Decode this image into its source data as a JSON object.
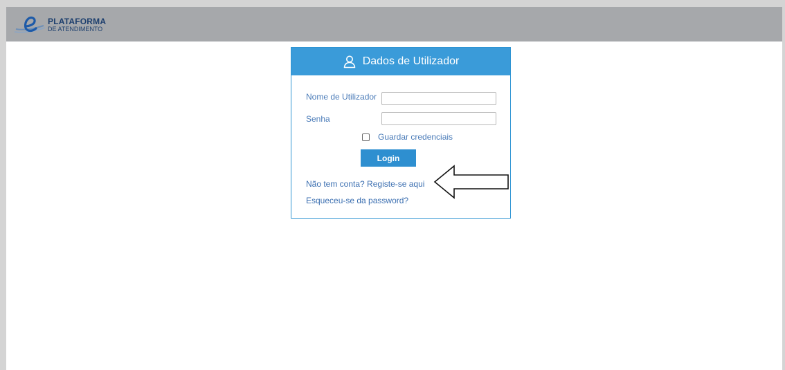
{
  "header": {
    "logo_title": "PLATAFORMA",
    "logo_subtitle": "DE ATENDIMENTO",
    "background": "#a6a8ab",
    "brand_color": "#1d3f6e"
  },
  "login": {
    "title": "Dados de Utilizador",
    "title_icon": "user-icon",
    "accent": "#3a9bd9",
    "username_label": "Nome de Utilizador",
    "username_value": "",
    "password_label": "Senha",
    "password_value": "",
    "remember_label": "Guardar credenciais",
    "remember_checked": false,
    "login_button": "Login",
    "register_link": "Não tem conta? Registe-se aqui",
    "forgot_link": "Esqueceu-se da password?"
  },
  "annotation": {
    "icon": "arrow-left-icon"
  }
}
